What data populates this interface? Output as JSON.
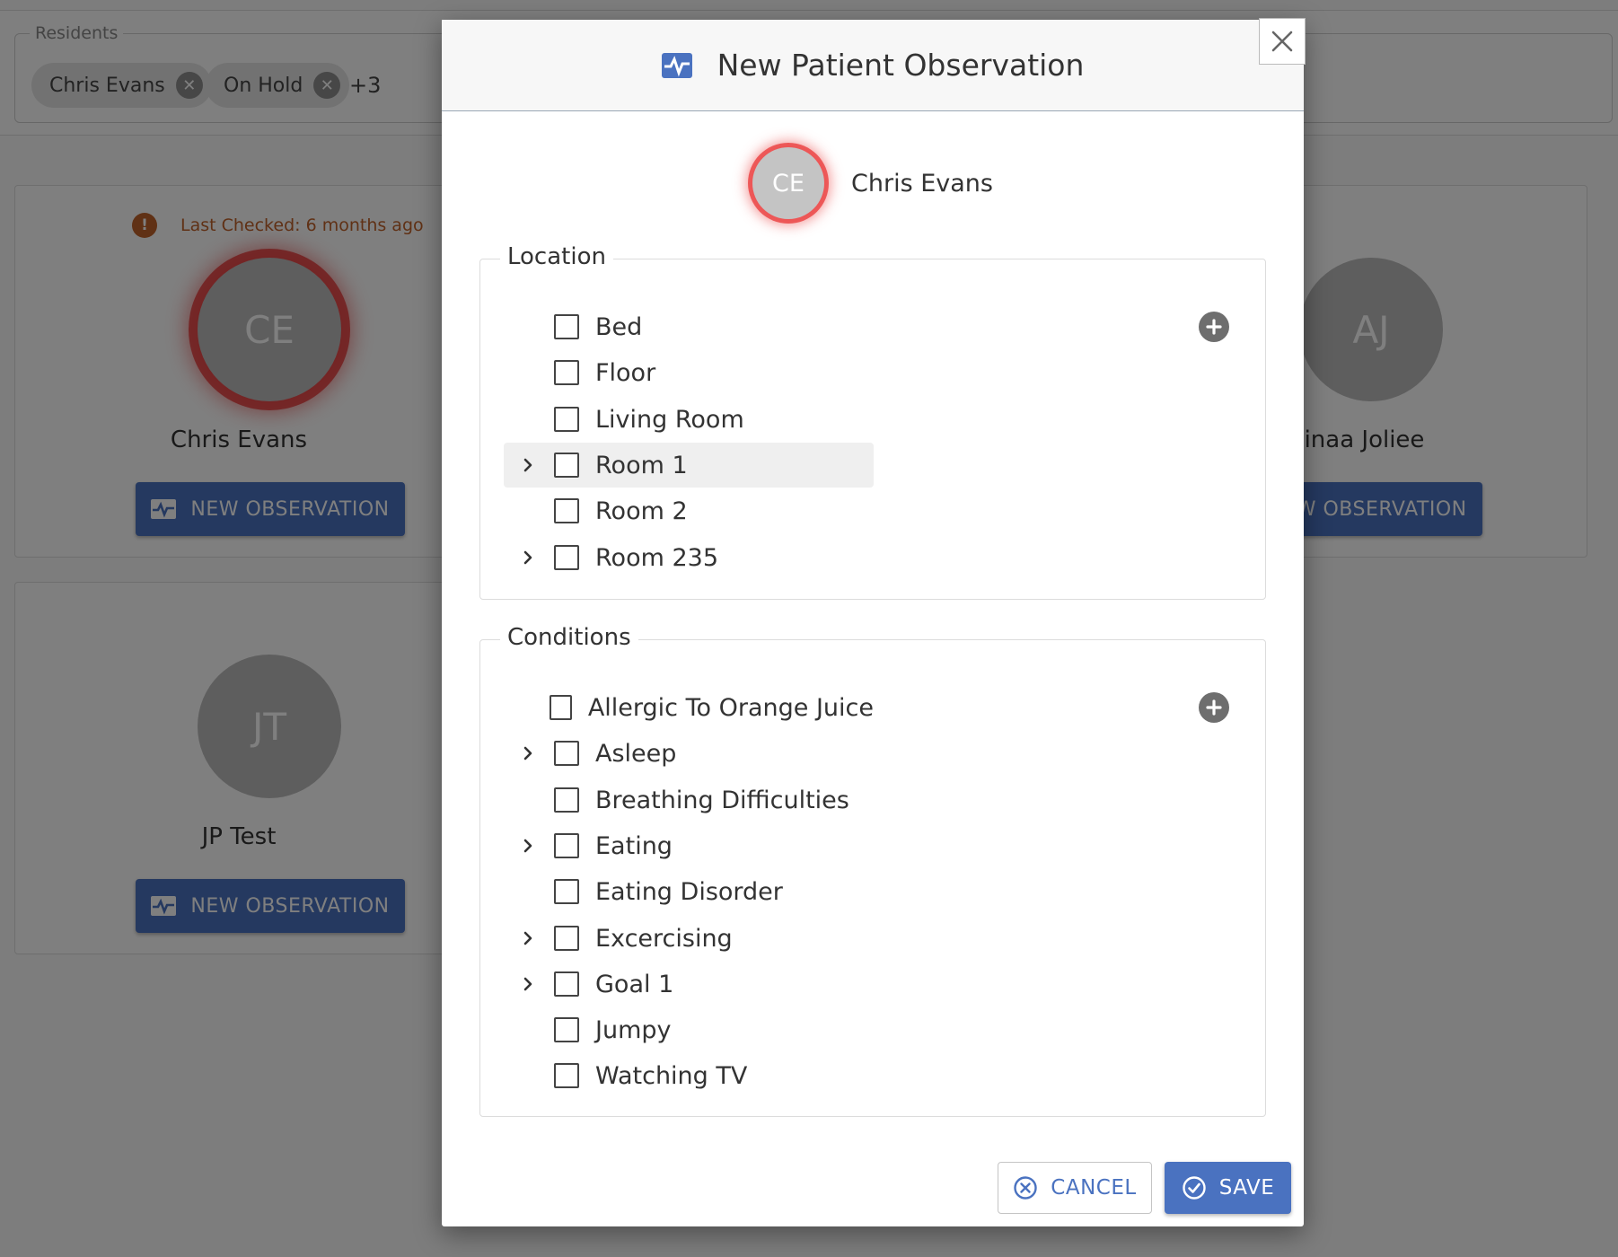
{
  "background": {
    "filter": {
      "legend": "Residents",
      "chips": [
        {
          "label": "Chris Evans"
        },
        {
          "label": "On Hold"
        }
      ],
      "more": "+3"
    },
    "cards": [
      {
        "initials": "CE",
        "name": "Chris Evans",
        "last_checked": "Last Checked: 6 months ago",
        "button": "NEW OBSERVATION"
      },
      {
        "initials": "AJ",
        "name": "Alinaa Joliee",
        "button": "NEW OBSERVATION"
      },
      {
        "initials": "JT",
        "name": "JP Test",
        "button": "NEW OBSERVATION"
      }
    ]
  },
  "modal": {
    "title": "New Patient Observation",
    "patient": {
      "initials": "CE",
      "name": "Chris Evans"
    },
    "location": {
      "legend": "Location",
      "items": [
        {
          "label": "Bed",
          "expandable": false,
          "checked": false
        },
        {
          "label": "Floor",
          "expandable": false,
          "checked": false
        },
        {
          "label": "Living Room",
          "expandable": false,
          "checked": false
        },
        {
          "label": "Room 1",
          "expandable": true,
          "checked": false
        },
        {
          "label": "Room 2",
          "expandable": false,
          "checked": false
        },
        {
          "label": "Room 235",
          "expandable": true,
          "checked": false
        }
      ]
    },
    "conditions": {
      "legend": "Conditions",
      "items": [
        {
          "label": "Allergic To Orange Juice",
          "expandable": false,
          "checked": false
        },
        {
          "label": "Asleep",
          "expandable": true,
          "checked": false
        },
        {
          "label": "Breathing Difficulties",
          "expandable": false,
          "checked": false
        },
        {
          "label": "Eating",
          "expandable": true,
          "checked": false
        },
        {
          "label": "Eating Disorder",
          "expandable": false,
          "checked": false
        },
        {
          "label": "Excercising",
          "expandable": true,
          "checked": false
        },
        {
          "label": "Goal 1",
          "expandable": true,
          "checked": false
        },
        {
          "label": "Jumpy",
          "expandable": false,
          "checked": false
        },
        {
          "label": "Watching TV",
          "expandable": false,
          "checked": false
        }
      ]
    },
    "cancel_label": "CANCEL",
    "save_label": "SAVE"
  },
  "colors": {
    "accent": "#4a72c0",
    "alert": "#e63c3c",
    "warning": "#c0622b"
  },
  "icons": [
    "activity-monitor-icon",
    "close-icon",
    "chevron-right-icon",
    "plus-circle-icon",
    "cancel-circle-icon",
    "check-circle-icon",
    "warning-icon",
    "remove-chip-icon"
  ]
}
